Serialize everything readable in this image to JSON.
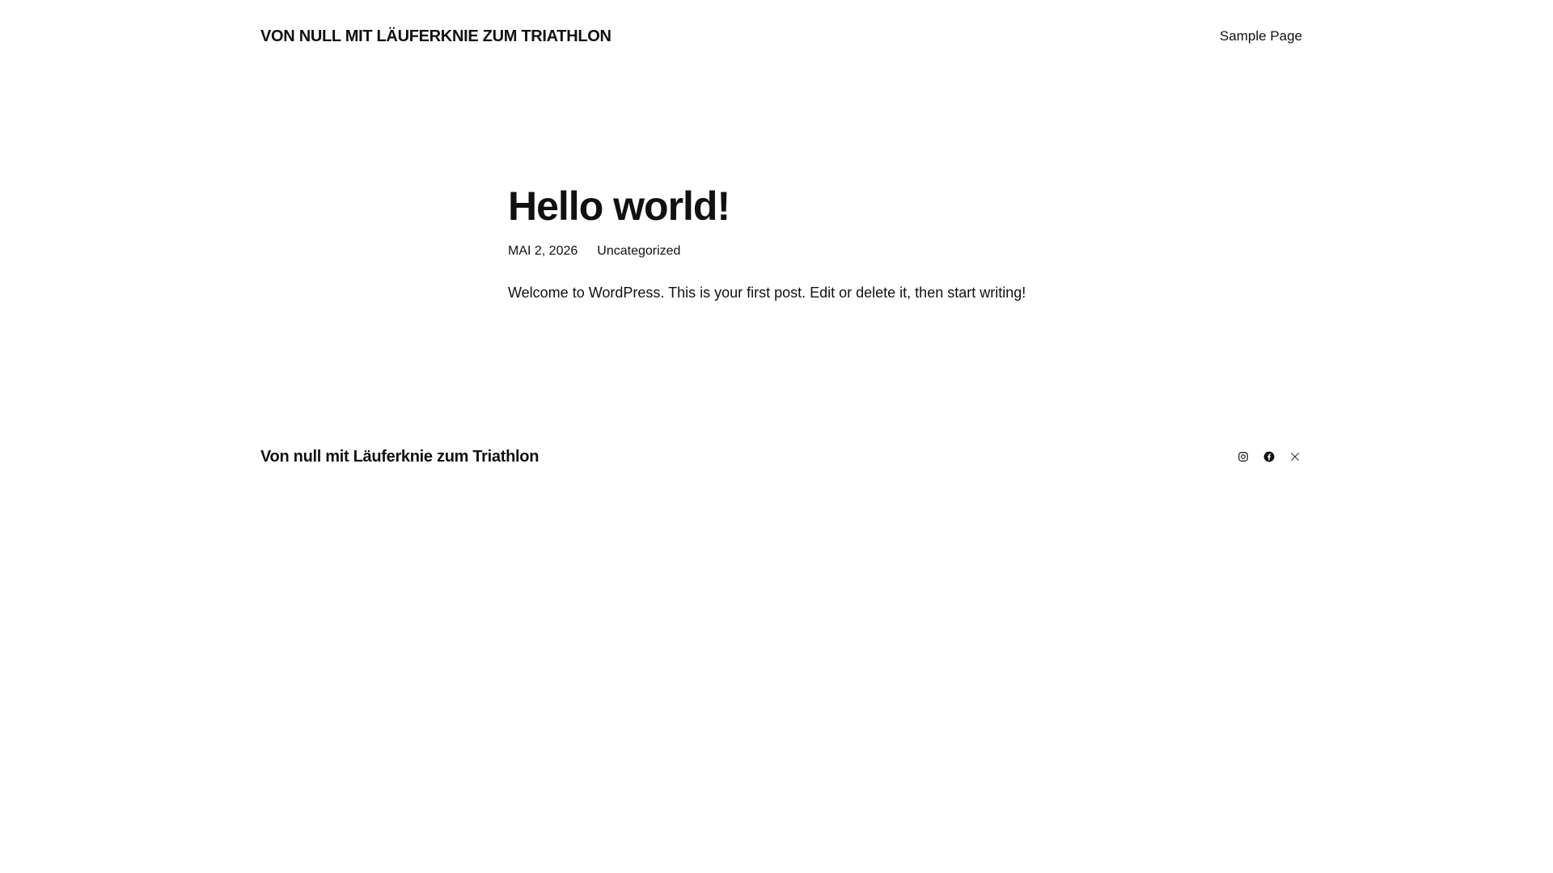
{
  "header": {
    "site_title": "VON NULL MIT LÄUFERKNIE ZUM TRIATHLON",
    "nav_items": [
      "Sample Page"
    ]
  },
  "post": {
    "title": "Hello world!",
    "date": "MAI 2, 2026",
    "category": "Uncategorized",
    "content": "Welcome to WordPress. This is your first post. Edit or delete it, then start writing!"
  },
  "footer": {
    "site_title": "Von null mit Läuferknie zum Triathlon",
    "social_icons": [
      "instagram-icon",
      "facebook-icon",
      "x-icon"
    ]
  },
  "colors": {
    "text": "#111111",
    "background": "#ffffff"
  }
}
